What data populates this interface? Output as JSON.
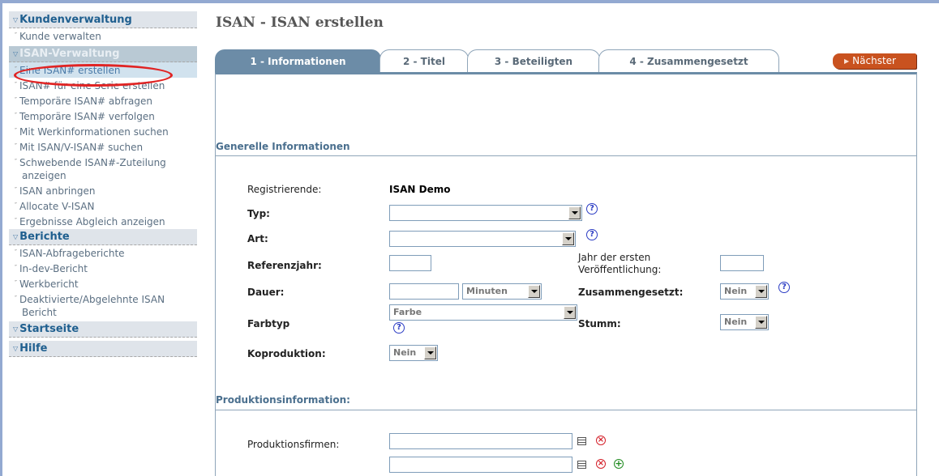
{
  "sidebar": {
    "sections": [
      {
        "title": "Kundenverwaltung",
        "items": [
          "Kunde verwalten"
        ]
      },
      {
        "title": "ISAN-Verwaltung",
        "items": [
          "Eine ISAN# erstellen",
          "ISAN# für eine Serie erstellen",
          "Temporäre ISAN# abfragen",
          "Temporäre ISAN# verfolgen",
          "Mit Werkinformationen suchen",
          "Mit ISAN/V-ISAN# suchen",
          "Schwebende ISAN#-Zuteilung anzeigen",
          "ISAN anbringen",
          "Allocate V-ISAN",
          "Ergebnisse Abgleich anzeigen"
        ]
      },
      {
        "title": "Berichte",
        "items": [
          "ISAN-Abfrageberichte",
          "In-dev-Bericht",
          "Werkbericht",
          "Deaktivierte/Abgelehnte ISAN Bericht"
        ]
      },
      {
        "title": "Startseite",
        "items": []
      },
      {
        "title": "Hilfe",
        "items": []
      }
    ]
  },
  "page": {
    "title": "ISAN - ISAN erstellen"
  },
  "tabs": [
    "1 - Informationen",
    "2 - Titel",
    "3 - Beteiligten",
    "4 - Zusammengesetzt"
  ],
  "next_button": "Nächster",
  "sections": {
    "general": "Generelle Informationen",
    "production": "Produktionsinformation:"
  },
  "form": {
    "registrant_label": "Registrierende:",
    "registrant_value": "ISAN Demo",
    "type_label": "Typ:",
    "kind_label": "Art:",
    "ref_year_label": "Referenzjahr:",
    "first_pub_label": "Jahr der ersten Veröffentlichung:",
    "duration_label": "Dauer:",
    "duration_unit": "Minuten",
    "composite_label": "Zusammengesetzt:",
    "composite_value": "Nein",
    "color_label": "Farbtyp",
    "color_value": "Farbe",
    "mute_label": "Stumm:",
    "mute_value": "Nein",
    "coproduction_label": "Koproduktion:",
    "coproduction_value": "Nein",
    "companies_label": "Produktionsfirmen:"
  },
  "icons": {
    "help": "help-icon",
    "list": "list-icon",
    "remove": "remove-icon",
    "add": "add-icon",
    "help_glyph": "?",
    "remove_glyph": "×",
    "add_glyph": "+"
  }
}
